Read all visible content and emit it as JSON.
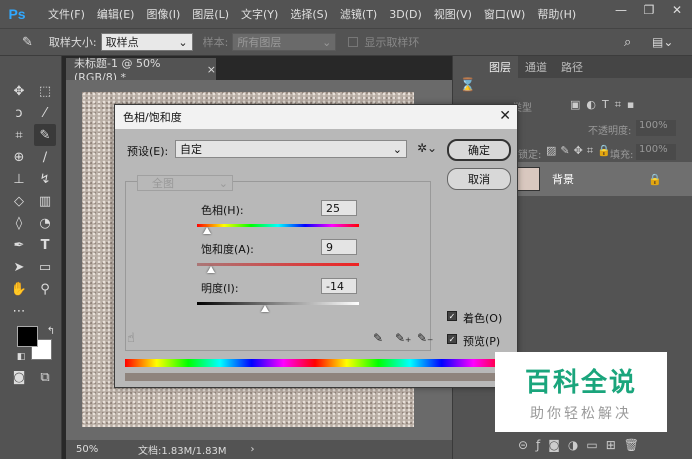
{
  "app": {
    "logo": "Ps"
  },
  "menu": [
    "文件(F)",
    "编辑(E)",
    "图像(I)",
    "图层(L)",
    "文字(Y)",
    "选择(S)",
    "滤镜(T)",
    "3D(D)",
    "视图(V)",
    "窗口(W)",
    "帮助(H)"
  ],
  "window_controls": {
    "minimize": "—",
    "restore": "❐",
    "close": "✕"
  },
  "options": {
    "sample_size_label": "取样大小:",
    "sample_size_value": "取样点",
    "sample_label": "样本:",
    "sample_value": "所有图层",
    "show_ring_label": "显示取样环"
  },
  "document": {
    "tab_title": "未标题-1 @ 50%(RGB/8) *",
    "tab_close": "×",
    "zoom": "50%",
    "doc_size": "文档:1.83M/1.83M"
  },
  "layers_panel": {
    "tabs": [
      "图层",
      "通道",
      "路径"
    ],
    "filter_kind": "类型",
    "opacity_label": "不透明度:",
    "opacity_value": "100%",
    "lock_label": "锁定:",
    "fill_label": "填充:",
    "fill_value": "100%",
    "layer_name": "背景"
  },
  "dialog": {
    "title": "色相/饱和度",
    "preset_label": "预设(E):",
    "preset_value": "自定",
    "channel_value": "全图",
    "ok_label": "确定",
    "cancel_label": "取消",
    "hue_label": "色相(H):",
    "hue_value": "25",
    "saturation_label": "饱和度(A):",
    "saturation_value": "9",
    "lightness_label": "明度(I):",
    "lightness_value": "-14",
    "colorize_label": "着色(O)",
    "colorize_checked": true,
    "preview_label": "预览(P)",
    "preview_checked": true,
    "hue_slider_fraction": 0.07,
    "saturation_slider_fraction": 0.09,
    "lightness_slider_fraction": 0.43
  },
  "watermark": {
    "main": "百科全说",
    "sub": "助你轻松解决"
  },
  "colors": {
    "foreground": "#000000",
    "background": "#ffffff",
    "watermark": "#1aa57c"
  }
}
